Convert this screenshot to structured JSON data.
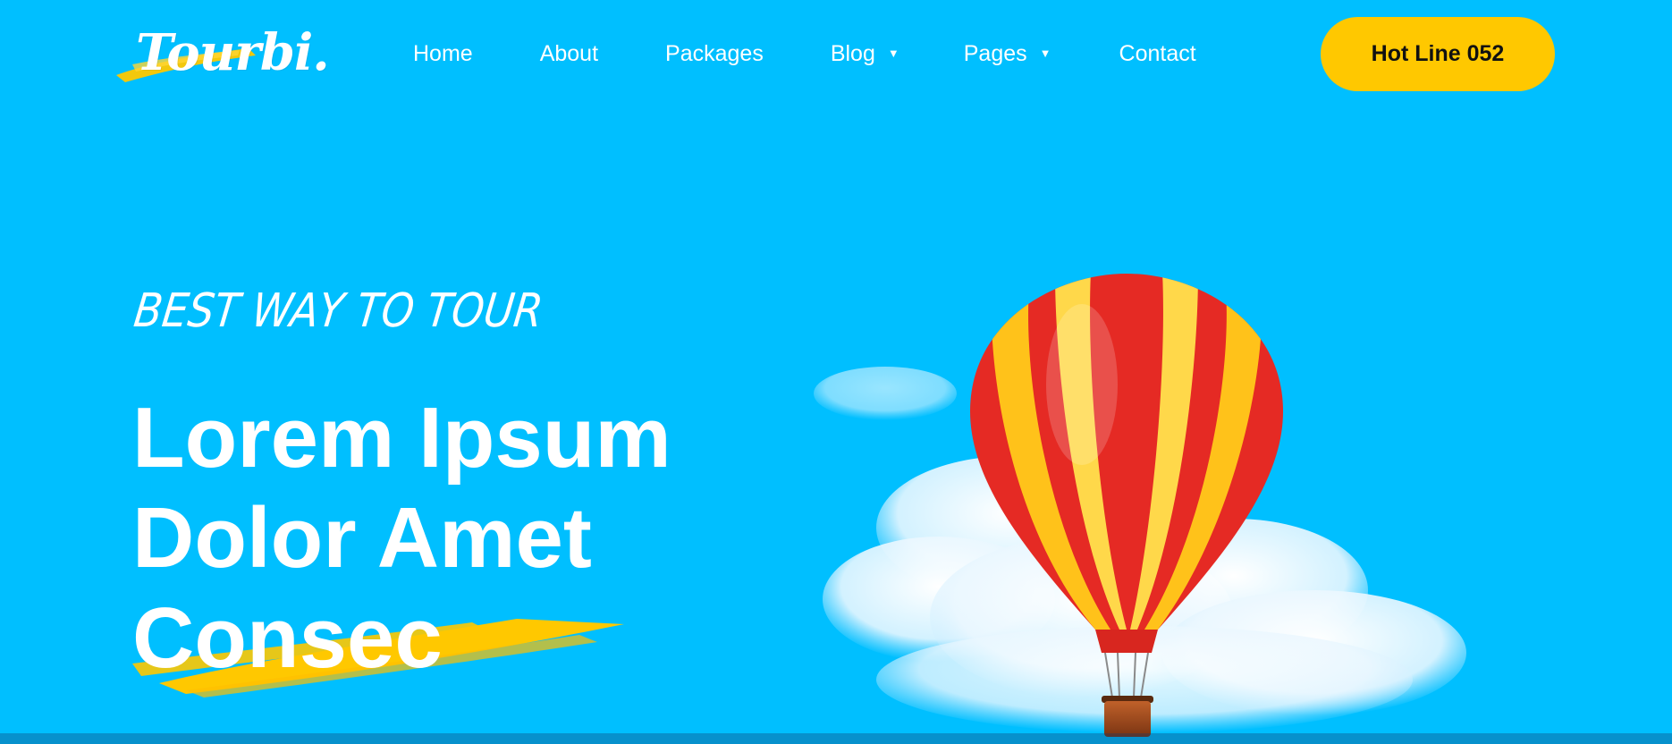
{
  "brand": {
    "logo_text": "Tourbi.",
    "accent_color": "#ffc800",
    "background_color": "#00bfff"
  },
  "nav": {
    "items": [
      {
        "label": "Home",
        "has_dropdown": false
      },
      {
        "label": "About",
        "has_dropdown": false
      },
      {
        "label": "Packages",
        "has_dropdown": false
      },
      {
        "label": "Blog",
        "has_dropdown": true
      },
      {
        "label": "Pages",
        "has_dropdown": true
      },
      {
        "label": "Contact",
        "has_dropdown": false
      }
    ],
    "dropdown_icon": "caret-down-icon"
  },
  "cta": {
    "hotline_label": "Hot Line 052"
  },
  "hero": {
    "tagline": "BEST WAY TO TOUR",
    "headline_lines": [
      "Lorem Ipsum",
      "Dolor Amet",
      "Consec"
    ],
    "illustration": "hot-air-balloon-over-clouds"
  }
}
